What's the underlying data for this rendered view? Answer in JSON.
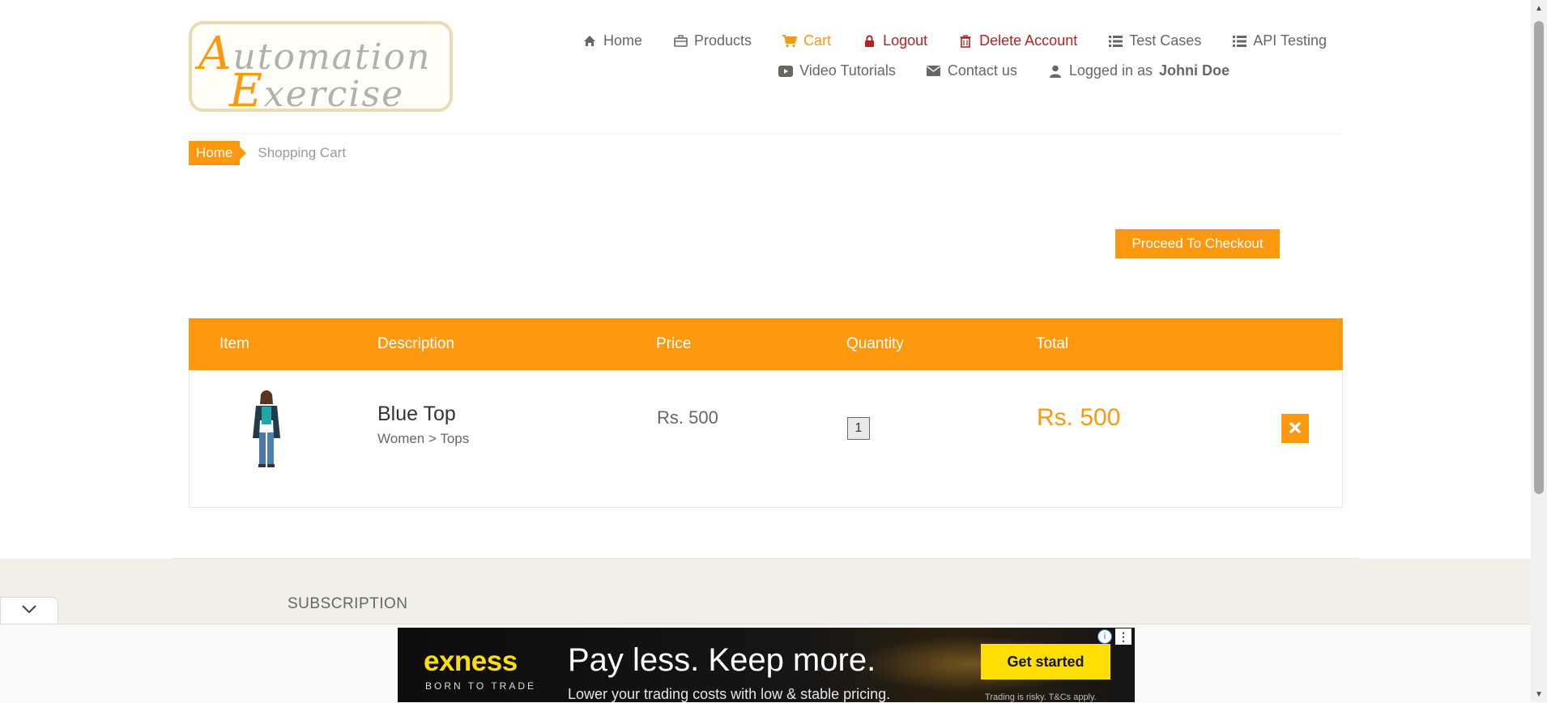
{
  "logo": {
    "line1_cap": "A",
    "line1_rest": "utomation",
    "line2_cap": "E",
    "line2_rest": "xercise"
  },
  "nav": {
    "home": "Home",
    "products": "Products",
    "cart": "Cart",
    "logout": "Logout",
    "delete_account": "Delete Account",
    "test_cases": "Test Cases",
    "api_testing": "API Testing",
    "video_tutorials": "Video Tutorials",
    "contact_us": "Contact us",
    "logged_in_prefix": "Logged in as",
    "logged_in_user": "Johni Doe"
  },
  "breadcrumb": {
    "home": "Home",
    "current": "Shopping Cart"
  },
  "checkout_button": "Proceed To Checkout",
  "table": {
    "headers": {
      "item": "Item",
      "description": "Description",
      "price": "Price",
      "quantity": "Quantity",
      "total": "Total"
    },
    "rows": [
      {
        "name": "Blue Top",
        "category": "Women > Tops",
        "price": "Rs. 500",
        "quantity": "1",
        "total": "Rs. 500",
        "delete_icon": "times-icon"
      }
    ]
  },
  "footer": {
    "subscription": "SUBSCRIPTION"
  },
  "ad": {
    "brand": "exness",
    "brand_tagline": "BORN TO TRADE",
    "headline": "Pay less. Keep more.",
    "subline": "Lower your trading costs with low & stable pricing.",
    "cta": "Get started",
    "disclaimer": "Trading is risky. T&Cs apply."
  },
  "colors": {
    "accent": "#fe980f",
    "danger": "#b22222",
    "text": "#696763",
    "footer_bg": "#f0f0e9"
  }
}
